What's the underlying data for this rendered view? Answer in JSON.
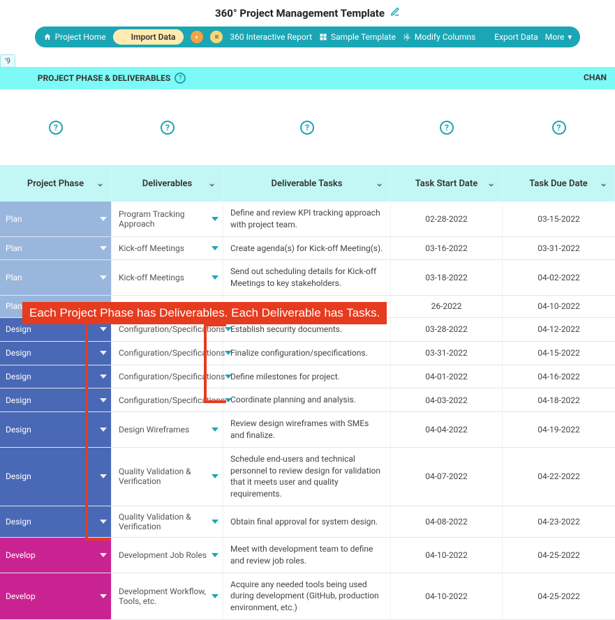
{
  "title": "360° Project Management Template",
  "toolbar": {
    "home": "Project Home",
    "import": "Import Data",
    "report": "360 Interactive Report",
    "sample": "Sample Template",
    "modify": "Modify Columns",
    "export": "Export Data",
    "more": "More"
  },
  "tab": "'9",
  "bands": {
    "left": "PROJECT PHASE & DELIVERABLES",
    "right": "CHAN"
  },
  "headers": {
    "phase": "Project Phase",
    "deliverables": "Deliverables",
    "tasks": "Deliverable Tasks",
    "start": "Task Start Date",
    "due": "Task Due Date"
  },
  "callout": "Each Project Phase has Deliverables. Each Deliverable has Tasks.",
  "rows": [
    {
      "phase": "Plan",
      "phaseClass": "phase-plan",
      "deliverable": "Program Tracking Approach",
      "task": "Define and review KPI tracking approach with project team.",
      "start": "02-28-2022",
      "due": "03-15-2022"
    },
    {
      "phase": "Plan",
      "phaseClass": "phase-plan",
      "deliverable": "Kick-off Meetings",
      "task": "Create agenda(s) for Kick-off Meeting(s).",
      "start": "03-16-2022",
      "due": "03-31-2022"
    },
    {
      "phase": "Plan",
      "phaseClass": "phase-plan",
      "deliverable": "Kick-off Meetings",
      "task": "Send out scheduling details for Kick-off Meetings to key stakeholders.",
      "start": "03-18-2022",
      "due": "04-02-2022"
    },
    {
      "phase": "Plan",
      "phaseClass": "phase-plan",
      "deliverable": "",
      "task": "",
      "start": "26-2022",
      "due": "04-10-2022"
    },
    {
      "phase": "Design",
      "phaseClass": "phase-design",
      "deliverable": "Configuration/Specifications",
      "task": "Establish security documents.",
      "start": "03-28-2022",
      "due": "04-12-2022"
    },
    {
      "phase": "Design",
      "phaseClass": "phase-design",
      "deliverable": "Configuration/Specifications",
      "task": "Finalize configuration/specifications.",
      "start": "03-31-2022",
      "due": "04-15-2022"
    },
    {
      "phase": "Design",
      "phaseClass": "phase-design",
      "deliverable": "Configuration/Specifications",
      "task": "Define milestones for project.",
      "start": "04-01-2022",
      "due": "04-16-2022"
    },
    {
      "phase": "Design",
      "phaseClass": "phase-design",
      "deliverable": "Configuration/Specifications",
      "task": "Coordinate planning and analysis.",
      "start": "04-03-2022",
      "due": "04-18-2022"
    },
    {
      "phase": "Design",
      "phaseClass": "phase-design",
      "deliverable": "Design Wireframes",
      "task": "Review design wireframes with SMEs and finalize.",
      "start": "04-04-2022",
      "due": "04-19-2022"
    },
    {
      "phase": "Design",
      "phaseClass": "phase-design",
      "deliverable": "Quality Validation & Verification",
      "task": "Schedule end-users and technical personnel to review design for validation that it meets user and quality requirements.",
      "start": "04-07-2022",
      "due": "04-22-2022"
    },
    {
      "phase": "Design",
      "phaseClass": "phase-design",
      "deliverable": "Quality Validation & Verification",
      "task": "Obtain final approval for system design.",
      "start": "04-08-2022",
      "due": "04-23-2022"
    },
    {
      "phase": "Develop",
      "phaseClass": "phase-develop",
      "deliverable": "Development Job Roles",
      "task": "Meet with development team to define and review job roles.",
      "start": "04-10-2022",
      "due": "04-25-2022"
    },
    {
      "phase": "Develop",
      "phaseClass": "phase-develop",
      "deliverable": "Development Workflow, Tools, etc.",
      "task": "Acquire any needed tools being used during development (GitHub, production environment, etc.)",
      "start": "04-10-2022",
      "due": "04-25-2022"
    }
  ]
}
